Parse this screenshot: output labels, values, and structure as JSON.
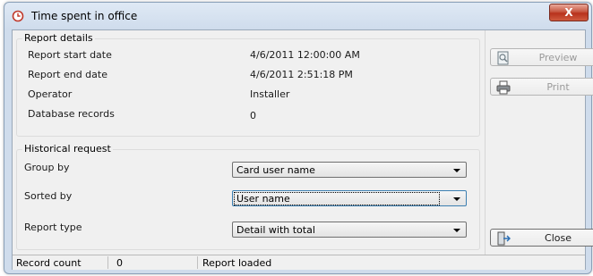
{
  "window": {
    "title": "Time spent in office",
    "close_label": "X"
  },
  "report_details": {
    "title": "Report details",
    "rows": [
      {
        "label": "Report start date",
        "value": "4/6/2011 12:00:00 AM"
      },
      {
        "label": "Report end date",
        "value": "4/6/2011 2:51:18 PM"
      },
      {
        "label": "Operator",
        "value": "Installer"
      },
      {
        "label": "Database records",
        "value": "0"
      }
    ]
  },
  "historical_request": {
    "title": "Historical request",
    "group_by": {
      "label": "Group by",
      "value": "Card user name"
    },
    "sorted_by": {
      "label": "Sorted by",
      "value": "User name"
    },
    "report_type": {
      "label": "Report type",
      "value": "Detail with total"
    }
  },
  "buttons": {
    "preview": "Preview",
    "print": "Print",
    "close": "Close"
  },
  "statusbar": {
    "record_count_label": "Record count",
    "record_count_value": "0",
    "status": "Report loaded"
  },
  "icons": [
    "clock-icon",
    "preview-icon",
    "printer-icon",
    "exit-door-icon"
  ]
}
